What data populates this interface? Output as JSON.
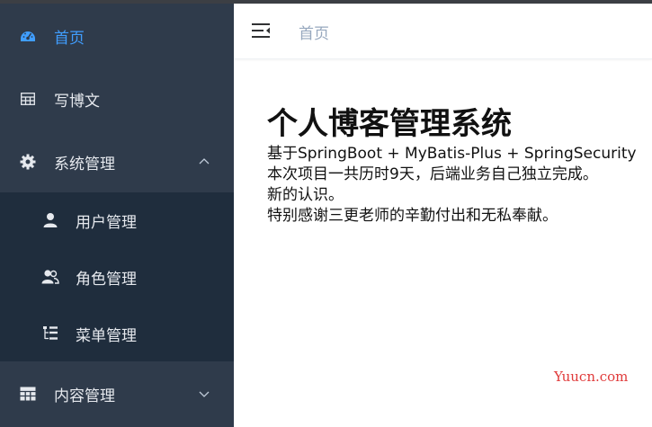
{
  "sidebar": {
    "items": [
      {
        "label": "首页",
        "icon": "dashboard-icon",
        "active": true
      },
      {
        "label": "写博文",
        "icon": "table-icon"
      },
      {
        "label": "系统管理",
        "icon": "gear-icon",
        "expanded": true,
        "children": [
          {
            "label": "用户管理",
            "icon": "user-icon"
          },
          {
            "label": "角色管理",
            "icon": "users-icon"
          },
          {
            "label": "菜单管理",
            "icon": "tree-icon"
          }
        ]
      },
      {
        "label": "内容管理",
        "icon": "grid-icon",
        "expanded": false
      }
    ]
  },
  "header": {
    "breadcrumb": "首页"
  },
  "main": {
    "title": "个人博客管理系统",
    "lines": [
      "基于SpringBoot + MyBatis-Plus + SpringSecurity",
      "本次项目一共历时9天，后端业务自己独立完成。",
      "新的认识。",
      "特别感谢三更老师的辛勤付出和无私奉献。"
    ]
  },
  "watermark": "Yuucn.com",
  "colors": {
    "sidebar_bg": "#2f3b4b",
    "submenu_bg": "#1f2d3d",
    "active": "#409eff",
    "breadcrumb": "#97a8be",
    "watermark": "#e03a3a"
  }
}
